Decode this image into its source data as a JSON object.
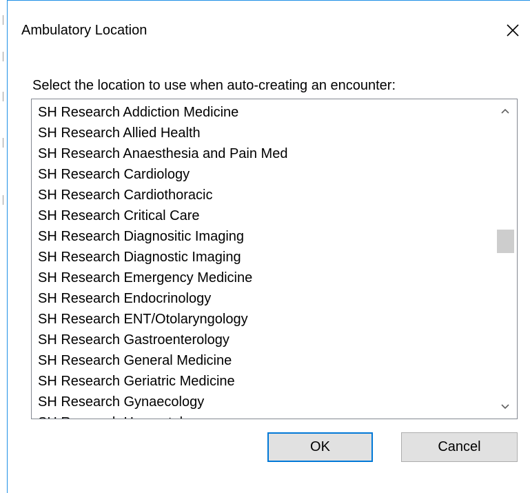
{
  "dialog": {
    "title": "Ambulatory Location",
    "close_icon": "close-icon",
    "prompt": "Select the location to use when auto-creating an encounter:",
    "locations": [
      "SH Research Addiction Medicine",
      "SH Research Allied Health",
      "SH Research Anaesthesia and Pain Med",
      "SH Research Cardiology",
      "SH Research Cardiothoracic",
      "SH Research Critical Care",
      "SH Research Diagnositic Imaging",
      "SH Research Diagnostic Imaging",
      "SH Research Emergency Medicine",
      "SH Research Endocrinology",
      "SH Research ENT/Otolaryngology",
      "SH Research Gastroenterology",
      "SH Research General Medicine",
      "SH Research Geriatric Medicine",
      "SH Research Gynaecology",
      "SH Research Haematology"
    ],
    "ok_label": "OK",
    "cancel_label": "Cancel"
  },
  "colors": {
    "accent": "#0078d7",
    "window_border": "#1e90e6",
    "scroll_thumb": "#cdcdcd",
    "button_face": "#e1e1e1"
  }
}
